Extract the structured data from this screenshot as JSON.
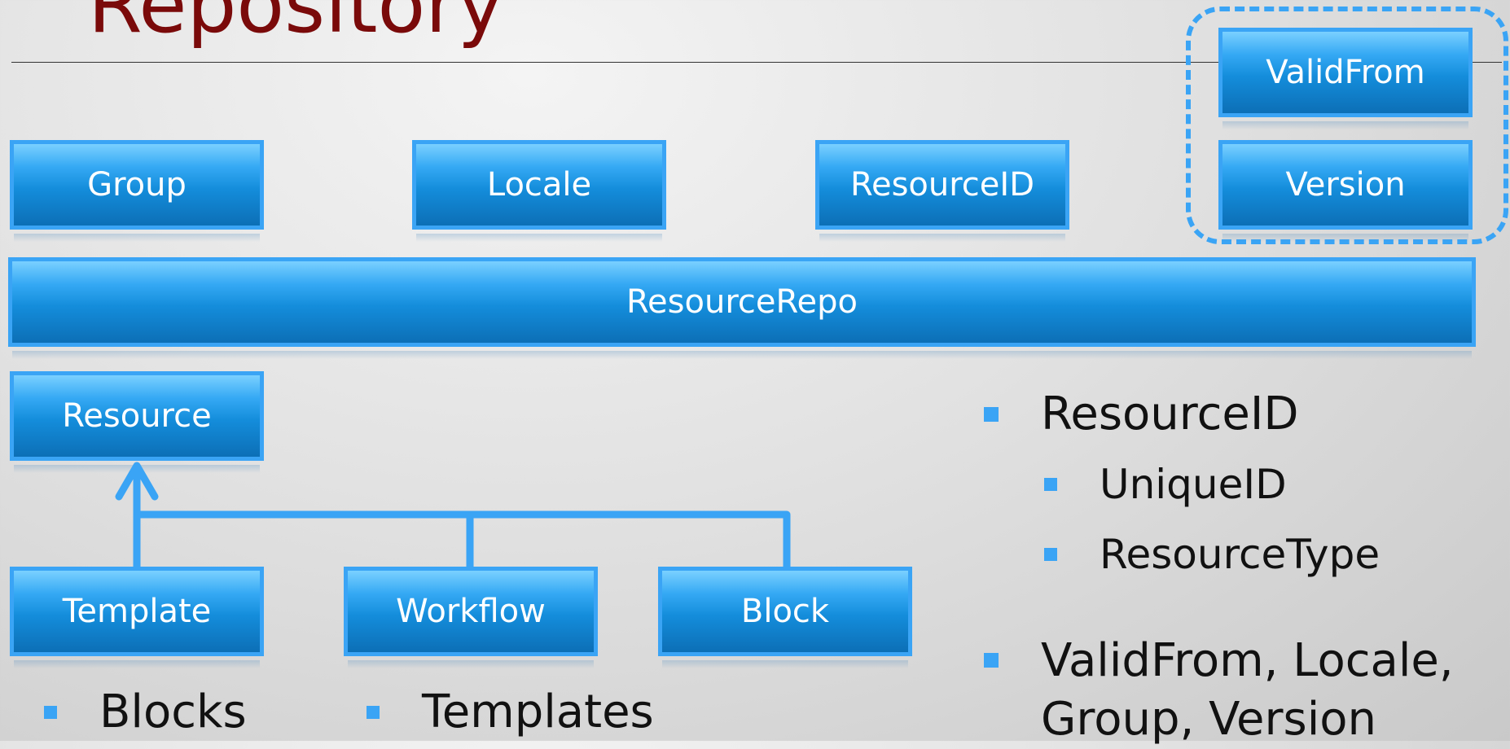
{
  "slide": {
    "title": "Repository"
  },
  "boxes": {
    "valid_from": "ValidFrom",
    "version": "Version",
    "group": "Group",
    "locale": "Locale",
    "resource_id": "ResourceID",
    "resource_repo": "ResourceRepo",
    "resource": "Resource",
    "template": "Template",
    "workflow": "Workflow",
    "block": "Block"
  },
  "bullets": {
    "right": [
      {
        "text": "ResourceID",
        "children": [
          "UniqueID",
          "ResourceType"
        ]
      },
      {
        "text": "ValidFrom, Locale, Group, Version"
      }
    ],
    "under_template": [
      "Blocks"
    ],
    "under_workflow": [
      "Templates"
    ]
  },
  "colors": {
    "box_fill": "#148ddb",
    "box_border": "#3aa4f5",
    "title": "#7a0a0a",
    "connector": "#3aa4f5"
  }
}
